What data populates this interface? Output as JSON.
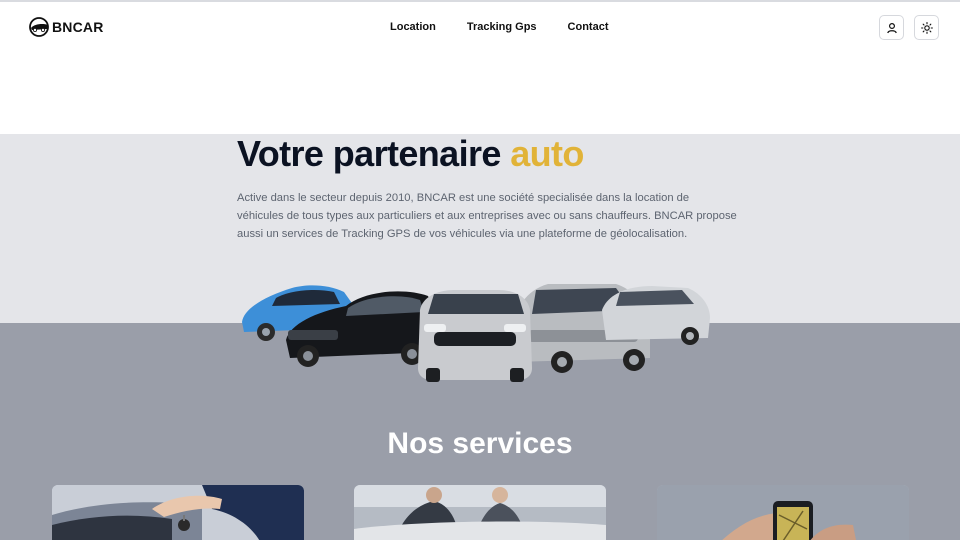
{
  "brand": {
    "name": "BNCAR",
    "logo_icon": "car-emblem-icon"
  },
  "nav": {
    "items": [
      {
        "label": "Location"
      },
      {
        "label": "Tracking Gps"
      },
      {
        "label": "Contact"
      }
    ]
  },
  "header_actions": {
    "user_icon": "user-icon",
    "theme_icon": "sun-icon"
  },
  "hero": {
    "title_main": "Votre partenaire ",
    "title_accent": "auto",
    "description": "Active dans le secteur depuis 2010, BNCAR est une société specialisée dans la location de véhicules de tous types aux particuliers et aux entreprises avec ou sans chauffeurs. BNCAR propose aussi un services de Tracking GPS de vos véhicules via une plateforme de géolocalisation.",
    "cars_image": "car-lineup-image"
  },
  "services": {
    "title": "Nos services",
    "cards": [
      {
        "image": "car-key-handover-photo"
      },
      {
        "image": "business-handshake-photo"
      },
      {
        "image": "gps-phone-photo"
      }
    ]
  },
  "colors": {
    "accent": "#e1b338",
    "hero_bg": "#e4e5e9",
    "lower_bg": "#9a9ea9",
    "title": "#0b1222"
  }
}
